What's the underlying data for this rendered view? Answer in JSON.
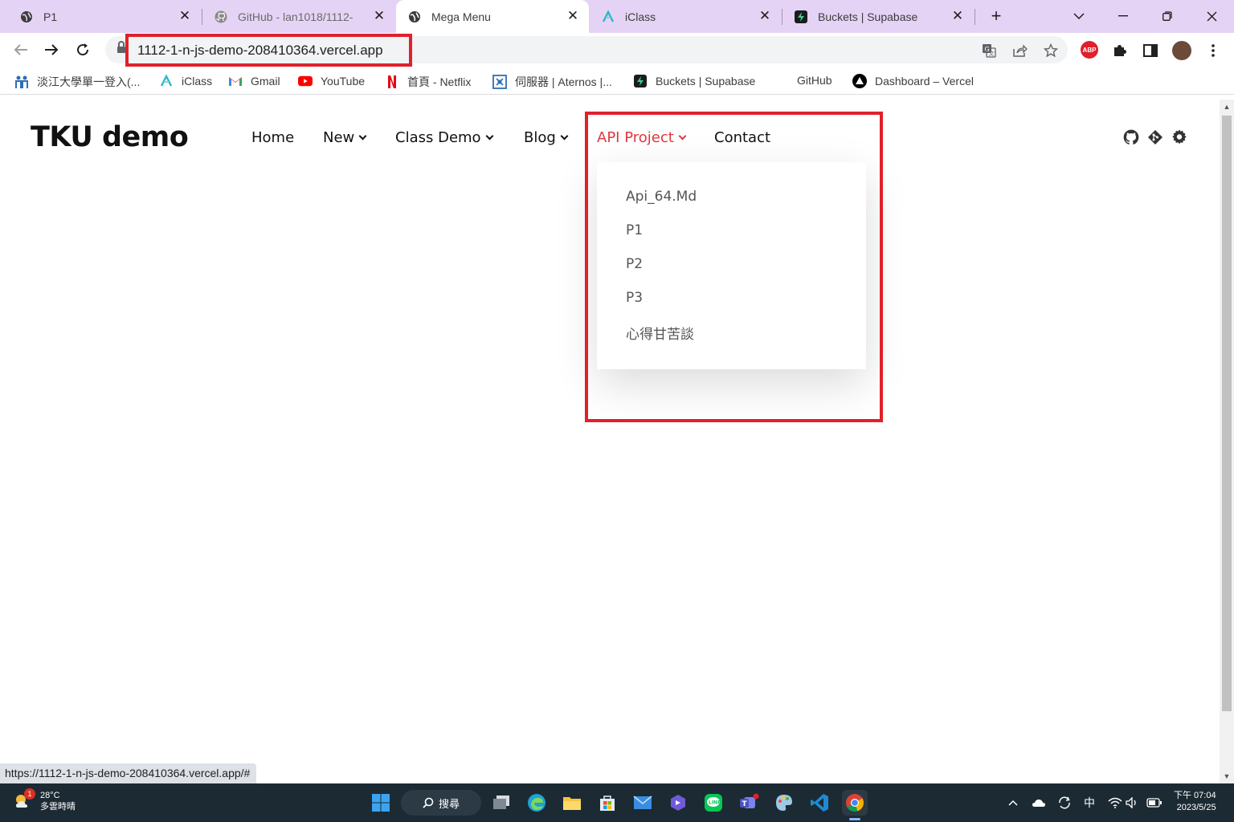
{
  "browser": {
    "tabs": [
      {
        "title": "P1",
        "favicon": "globe-icon",
        "active": false
      },
      {
        "title": "GitHub - lan1018/1112-",
        "favicon": "github-icon",
        "active": false
      },
      {
        "title": "Mega Menu",
        "favicon": "globe-icon",
        "active": true
      },
      {
        "title": "iClass",
        "favicon": "iclass-icon",
        "active": false
      },
      {
        "title": "Buckets | Supabase",
        "favicon": "supabase-icon",
        "active": false
      }
    ],
    "url": "1112-1-n-js-demo-208410364.vercel.app",
    "bookmarks": [
      {
        "label": "淡江大學單一登入(...",
        "icon": "tku-icon"
      },
      {
        "label": "iClass",
        "icon": "iclass-icon"
      },
      {
        "label": "Gmail",
        "icon": "gmail-icon"
      },
      {
        "label": "YouTube",
        "icon": "youtube-icon"
      },
      {
        "label": "首頁 - Netflix",
        "icon": "netflix-icon"
      },
      {
        "label": "伺服器 | Aternos |...",
        "icon": "aternos-icon"
      },
      {
        "label": "Buckets | Supabase",
        "icon": "supabase-icon"
      },
      {
        "label": "GitHub",
        "icon": "none"
      },
      {
        "label": "Dashboard – Vercel",
        "icon": "vercel-icon"
      }
    ],
    "status_url": "https://1112-1-n-js-demo-208410364.vercel.app/#",
    "highlight_color": "#e0202a"
  },
  "site": {
    "brand": "TKU demo",
    "nav": [
      {
        "label": "Home",
        "has_dropdown": false,
        "active": false
      },
      {
        "label": "New",
        "has_dropdown": true,
        "active": false
      },
      {
        "label": "Class Demo",
        "has_dropdown": true,
        "active": false
      },
      {
        "label": "Blog",
        "has_dropdown": true,
        "active": false
      },
      {
        "label": "API Project",
        "has_dropdown": true,
        "active": true
      },
      {
        "label": "Contact",
        "has_dropdown": false,
        "active": false
      }
    ],
    "active_color": "#e0383e",
    "dropdown_items": [
      "Api_64.Md",
      "P1",
      "P2",
      "P3",
      "心得甘苦談"
    ],
    "social_icons": [
      "github-icon",
      "git-icon",
      "gear-icon"
    ]
  },
  "taskbar": {
    "weather": {
      "temp": "28°C",
      "desc": "多雲時晴",
      "badge": "1"
    },
    "search_label": "搜尋",
    "apps": [
      "start-icon",
      "task-view-icon",
      "edge-icon",
      "file-explorer-icon",
      "store-icon",
      "mail-icon",
      "copilot-icon",
      "line-icon",
      "teams-icon",
      "paint-icon",
      "vscode-icon",
      "chrome-icon"
    ],
    "tray_lang": "中",
    "clock_time": "下午 07:04",
    "clock_date": "2023/5/25"
  }
}
